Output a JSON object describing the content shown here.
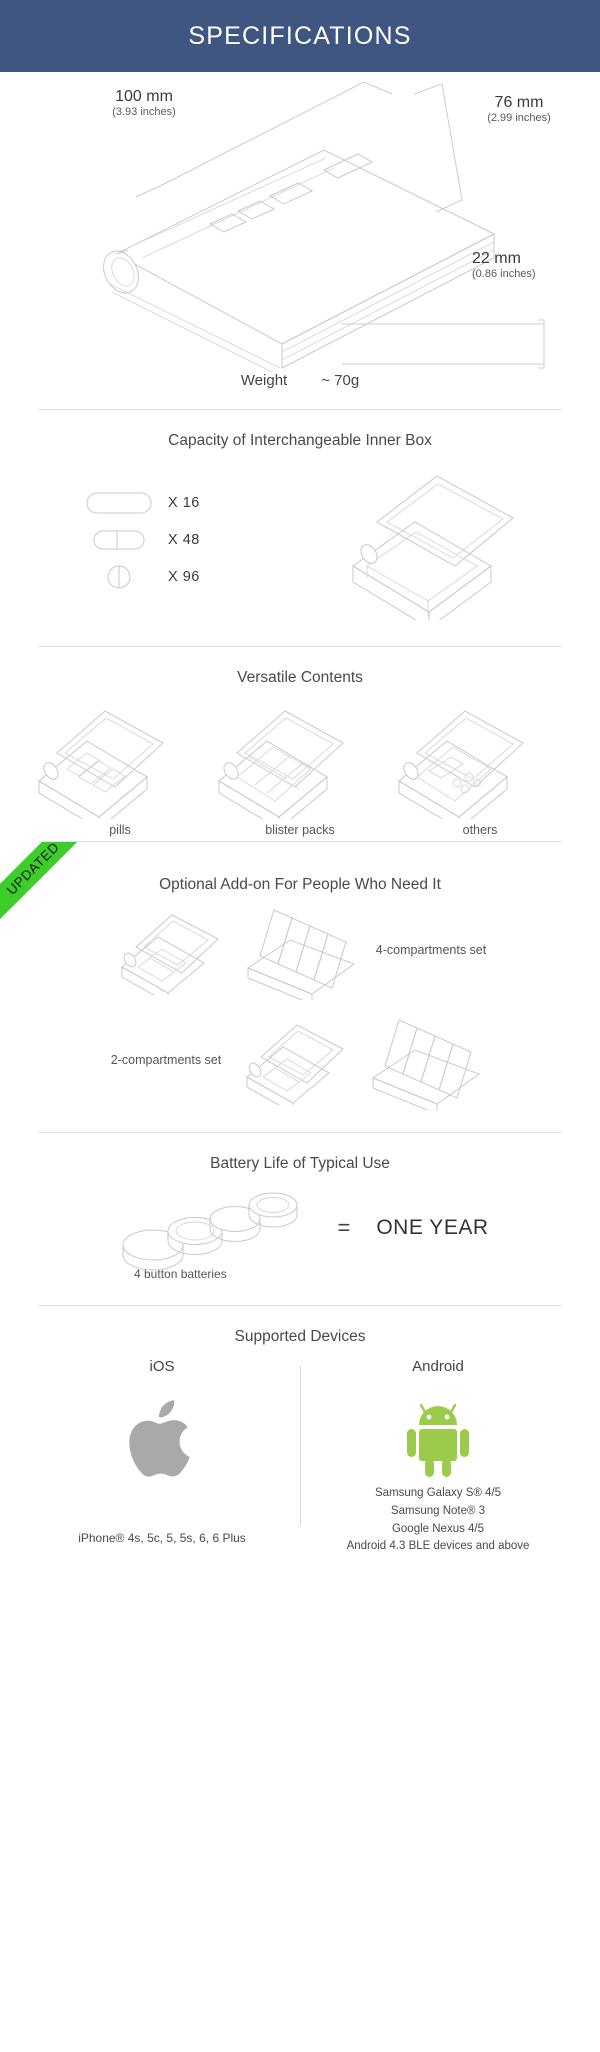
{
  "header": {
    "title": "SPECIFICATIONS"
  },
  "dimensions": {
    "length": {
      "value": "100 mm",
      "inches": "(3.93 inches)"
    },
    "width": {
      "value": "76 mm",
      "inches": "(2.99 inches)"
    },
    "thickness": {
      "value": "22 mm",
      "inches": "(0.86 inches)"
    },
    "weight_label": "Weight",
    "weight_value": "~  70g"
  },
  "capacity": {
    "title": "Capacity of Interchangeable Inner Box",
    "rows": [
      {
        "icon": "large-capsule-icon",
        "count": "X  16"
      },
      {
        "icon": "medium-capsule-icon",
        "count": "X  48"
      },
      {
        "icon": "round-tablet-icon",
        "count": "X  96"
      }
    ]
  },
  "versatile": {
    "title": "Versatile Contents",
    "items": [
      {
        "label": "pills"
      },
      {
        "label": "blister packs"
      },
      {
        "label": "others"
      }
    ]
  },
  "addon": {
    "ribbon": "UPDATED",
    "title": "Optional Add-on For People Who Need It",
    "four_label": "4-compartments set",
    "two_label": "2-compartments set"
  },
  "battery": {
    "title": "Battery Life of Typical Use",
    "caption": "4 button batteries",
    "equals": "=",
    "result": "ONE YEAR"
  },
  "devices": {
    "title": "Supported Devices",
    "ios": {
      "name": "iOS",
      "logo": "apple-logo",
      "models": "iPhone®  4s, 5c, 5, 5s, 6, 6 Plus"
    },
    "android": {
      "name": "Android",
      "logo": "android-robot-logo",
      "models": [
        "Samsung Galaxy S® 4/5",
        "Samsung Note® 3",
        "Google Nexus 4/5",
        "Android 4.3 BLE devices and above"
      ]
    }
  },
  "colors": {
    "header_bg": "#3e5680",
    "ribbon": "#3ccd28",
    "line": "#c9c9c9",
    "android_green": "#9ccb4b",
    "apple_gray": "#a9a9a9"
  }
}
